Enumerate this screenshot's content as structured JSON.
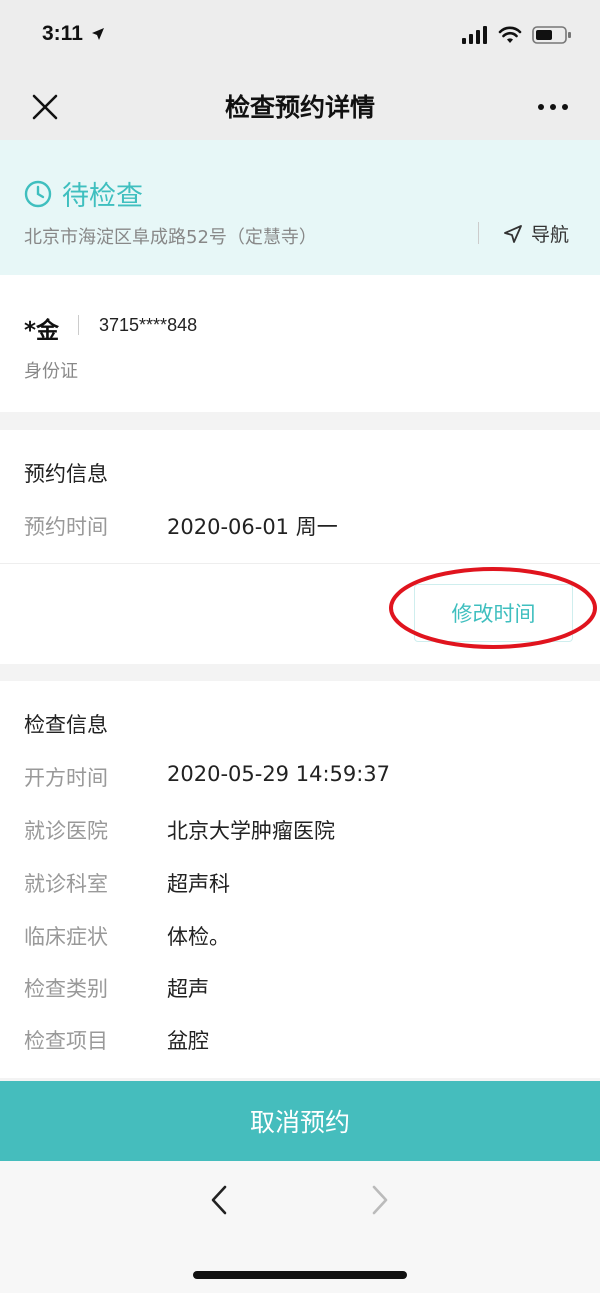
{
  "status_bar": {
    "time": "3:11"
  },
  "nav": {
    "title": "检查预约详情"
  },
  "status_card": {
    "status": "待检查",
    "address": "北京市海淀区阜成路52号（定慧寺）",
    "navigate_label": "导航"
  },
  "patient": {
    "name": "*金",
    "id_number": "3715****848",
    "id_type": "身份证"
  },
  "appointment": {
    "section_title": "预约信息",
    "time_label": "预约时间",
    "time_value": "2020-06-01 周一",
    "modify_label": "修改时间"
  },
  "exam": {
    "section_title": "检查信息",
    "rows": [
      {
        "label": "开方时间",
        "value": "2020-05-29 14:59:37"
      },
      {
        "label": "就诊医院",
        "value": "北京大学肿瘤医院"
      },
      {
        "label": "就诊科室",
        "value": "超声科"
      },
      {
        "label": "临床症状",
        "value": "体检。"
      },
      {
        "label": "检查类别",
        "value": "超声"
      },
      {
        "label": "检查项目",
        "value": "盆腔"
      }
    ]
  },
  "footer": {
    "cancel_label": "取消预约"
  },
  "colors": {
    "accent": "#3fbfbf",
    "cancel_bg": "#45bdbd",
    "status_bg": "#e7f7f7",
    "annotation": "#e0141e"
  },
  "icons": [
    "location-arrow-icon",
    "signal-icon",
    "wifi-icon",
    "battery-icon",
    "close-icon",
    "more-icon",
    "clock-icon",
    "navigate-icon",
    "back-arrow-icon",
    "forward-arrow-icon"
  ]
}
